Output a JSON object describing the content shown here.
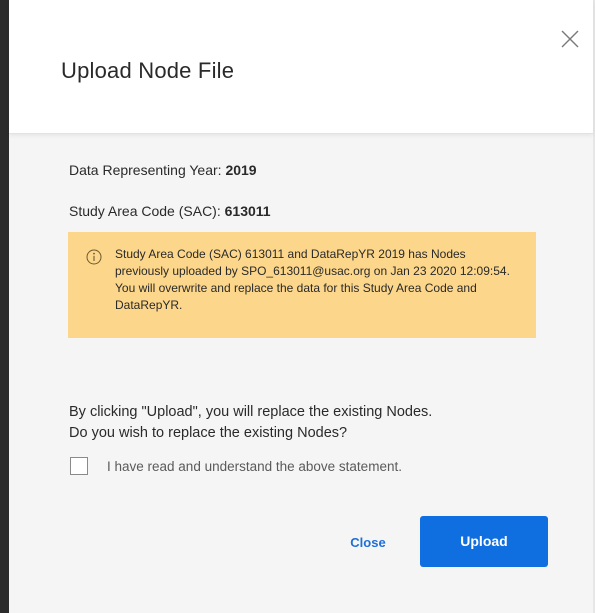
{
  "dialog": {
    "title": "Upload Node File",
    "close_icon": "close-icon"
  },
  "info": {
    "year_label": "Data Representing Year: ",
    "year_value": "2019",
    "sac_label": "Study Area Code (SAC): ",
    "sac_value": "613011"
  },
  "warning": {
    "icon": "info-circle-icon",
    "text": "Study Area Code (SAC) 613011 and DataRepYR 2019 has Nodes previously uploaded by SPO_613011@usac.org on Jan 23 2020 12:09:54. You will overwrite and replace the data for this Study Area Code and DataRepYR.",
    "background_color": "#fcd68a"
  },
  "confirmation": {
    "line1": "By clicking \"Upload\", you will replace the existing Nodes.",
    "line2": "Do you wish to replace the existing Nodes?",
    "checkbox_label": "I have read and understand the above statement.",
    "checkbox_checked": false
  },
  "actions": {
    "close_label": "Close",
    "upload_label": "Upload",
    "accent_color": "#0f6fe0"
  }
}
